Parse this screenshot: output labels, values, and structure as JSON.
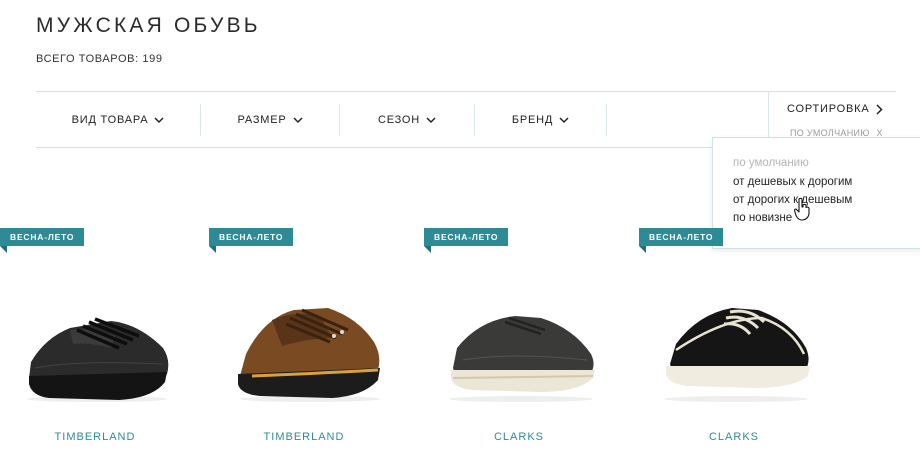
{
  "page": {
    "title": "МУЖСКАЯ ОБУВЬ",
    "total": "ВСЕГО ТОВАРОВ: 199"
  },
  "filters": [
    {
      "label": "ВИД ТОВАРА",
      "icon": "chevron-down-icon"
    },
    {
      "label": "РАЗМЕР",
      "icon": "chevron-down-icon"
    },
    {
      "label": "СЕЗОН",
      "icon": "chevron-down-icon"
    },
    {
      "label": "БРЕНД",
      "icon": "chevron-down-icon"
    }
  ],
  "sort": {
    "label": "СОРТИРОВКА",
    "current": "ПО УМОЛЧАНИЮ",
    "clear_icon": "X",
    "options": [
      {
        "label": "по умолчанию",
        "active": true
      },
      {
        "label": "от дешевых к дорогим",
        "active": false
      },
      {
        "label": "от дорогих к дешевым",
        "active": false
      },
      {
        "label": "по новизне",
        "active": false
      }
    ]
  },
  "products": [
    {
      "badge": "ВЕСНА-ЛЕТО",
      "brand": "TIMBERLAND",
      "image": "black-leather-sneaker"
    },
    {
      "badge": "ВЕСНА-ЛЕТО",
      "brand": "TIMBERLAND",
      "image": "brown-hiking-shoe"
    },
    {
      "badge": "ВЕСНА-ЛЕТО",
      "brand": "CLARKS",
      "image": "dark-grey-derby-shoe"
    },
    {
      "badge": "ВЕСНА-ЛЕТО",
      "brand": "CLARKS",
      "image": "black-suede-boat-shoe"
    }
  ],
  "colors": {
    "accent": "#2e8b96",
    "border": "#cfe3e6",
    "text": "#222222",
    "muted": "#9a9a9a"
  }
}
